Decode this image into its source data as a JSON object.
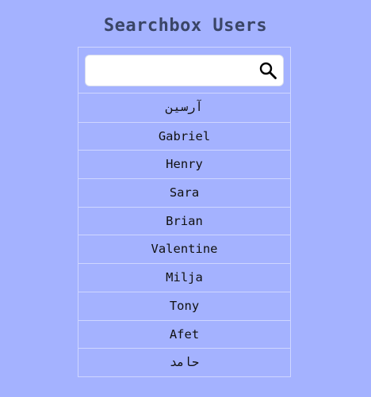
{
  "header": {
    "title": "Searchbox Users"
  },
  "search": {
    "value": "",
    "placeholder": "",
    "icon": "search-icon"
  },
  "users": [
    {
      "name": "آرسين"
    },
    {
      "name": "Gabriel"
    },
    {
      "name": "Henry"
    },
    {
      "name": "Sara"
    },
    {
      "name": "Brian"
    },
    {
      "name": "Valentine"
    },
    {
      "name": "Milja"
    },
    {
      "name": "Tony"
    },
    {
      "name": "Afet"
    },
    {
      "name": "حامد"
    }
  ],
  "colors": {
    "background": "#a4b2ff",
    "title": "#3a4566",
    "border": "#cfd6ff",
    "input_background": "#ffffff"
  }
}
